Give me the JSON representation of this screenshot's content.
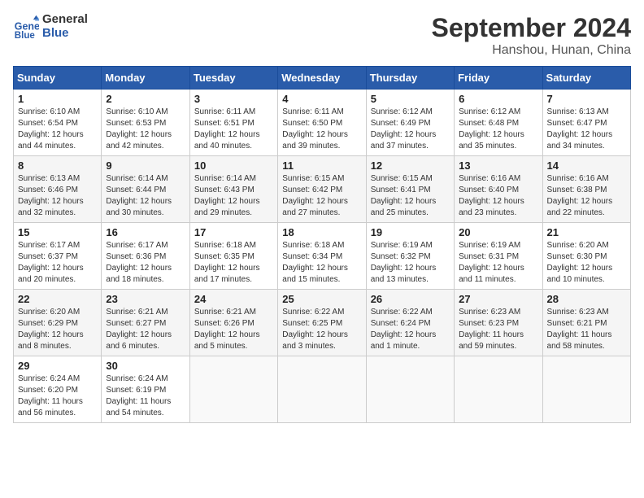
{
  "header": {
    "logo_line1": "General",
    "logo_line2": "Blue",
    "month": "September 2024",
    "location": "Hanshou, Hunan, China"
  },
  "weekdays": [
    "Sunday",
    "Monday",
    "Tuesday",
    "Wednesday",
    "Thursday",
    "Friday",
    "Saturday"
  ],
  "weeks": [
    [
      {
        "day": "1",
        "sunrise": "6:10 AM",
        "sunset": "6:54 PM",
        "daylight": "12 hours and 44 minutes."
      },
      {
        "day": "2",
        "sunrise": "6:10 AM",
        "sunset": "6:53 PM",
        "daylight": "12 hours and 42 minutes."
      },
      {
        "day": "3",
        "sunrise": "6:11 AM",
        "sunset": "6:51 PM",
        "daylight": "12 hours and 40 minutes."
      },
      {
        "day": "4",
        "sunrise": "6:11 AM",
        "sunset": "6:50 PM",
        "daylight": "12 hours and 39 minutes."
      },
      {
        "day": "5",
        "sunrise": "6:12 AM",
        "sunset": "6:49 PM",
        "daylight": "12 hours and 37 minutes."
      },
      {
        "day": "6",
        "sunrise": "6:12 AM",
        "sunset": "6:48 PM",
        "daylight": "12 hours and 35 minutes."
      },
      {
        "day": "7",
        "sunrise": "6:13 AM",
        "sunset": "6:47 PM",
        "daylight": "12 hours and 34 minutes."
      }
    ],
    [
      {
        "day": "8",
        "sunrise": "6:13 AM",
        "sunset": "6:46 PM",
        "daylight": "12 hours and 32 minutes."
      },
      {
        "day": "9",
        "sunrise": "6:14 AM",
        "sunset": "6:44 PM",
        "daylight": "12 hours and 30 minutes."
      },
      {
        "day": "10",
        "sunrise": "6:14 AM",
        "sunset": "6:43 PM",
        "daylight": "12 hours and 29 minutes."
      },
      {
        "day": "11",
        "sunrise": "6:15 AM",
        "sunset": "6:42 PM",
        "daylight": "12 hours and 27 minutes."
      },
      {
        "day": "12",
        "sunrise": "6:15 AM",
        "sunset": "6:41 PM",
        "daylight": "12 hours and 25 minutes."
      },
      {
        "day": "13",
        "sunrise": "6:16 AM",
        "sunset": "6:40 PM",
        "daylight": "12 hours and 23 minutes."
      },
      {
        "day": "14",
        "sunrise": "6:16 AM",
        "sunset": "6:38 PM",
        "daylight": "12 hours and 22 minutes."
      }
    ],
    [
      {
        "day": "15",
        "sunrise": "6:17 AM",
        "sunset": "6:37 PM",
        "daylight": "12 hours and 20 minutes."
      },
      {
        "day": "16",
        "sunrise": "6:17 AM",
        "sunset": "6:36 PM",
        "daylight": "12 hours and 18 minutes."
      },
      {
        "day": "17",
        "sunrise": "6:18 AM",
        "sunset": "6:35 PM",
        "daylight": "12 hours and 17 minutes."
      },
      {
        "day": "18",
        "sunrise": "6:18 AM",
        "sunset": "6:34 PM",
        "daylight": "12 hours and 15 minutes."
      },
      {
        "day": "19",
        "sunrise": "6:19 AM",
        "sunset": "6:32 PM",
        "daylight": "12 hours and 13 minutes."
      },
      {
        "day": "20",
        "sunrise": "6:19 AM",
        "sunset": "6:31 PM",
        "daylight": "12 hours and 11 minutes."
      },
      {
        "day": "21",
        "sunrise": "6:20 AM",
        "sunset": "6:30 PM",
        "daylight": "12 hours and 10 minutes."
      }
    ],
    [
      {
        "day": "22",
        "sunrise": "6:20 AM",
        "sunset": "6:29 PM",
        "daylight": "12 hours and 8 minutes."
      },
      {
        "day": "23",
        "sunrise": "6:21 AM",
        "sunset": "6:27 PM",
        "daylight": "12 hours and 6 minutes."
      },
      {
        "day": "24",
        "sunrise": "6:21 AM",
        "sunset": "6:26 PM",
        "daylight": "12 hours and 5 minutes."
      },
      {
        "day": "25",
        "sunrise": "6:22 AM",
        "sunset": "6:25 PM",
        "daylight": "12 hours and 3 minutes."
      },
      {
        "day": "26",
        "sunrise": "6:22 AM",
        "sunset": "6:24 PM",
        "daylight": "12 hours and 1 minute."
      },
      {
        "day": "27",
        "sunrise": "6:23 AM",
        "sunset": "6:23 PM",
        "daylight": "11 hours and 59 minutes."
      },
      {
        "day": "28",
        "sunrise": "6:23 AM",
        "sunset": "6:21 PM",
        "daylight": "11 hours and 58 minutes."
      }
    ],
    [
      {
        "day": "29",
        "sunrise": "6:24 AM",
        "sunset": "6:20 PM",
        "daylight": "11 hours and 56 minutes."
      },
      {
        "day": "30",
        "sunrise": "6:24 AM",
        "sunset": "6:19 PM",
        "daylight": "11 hours and 54 minutes."
      },
      null,
      null,
      null,
      null,
      null
    ]
  ]
}
